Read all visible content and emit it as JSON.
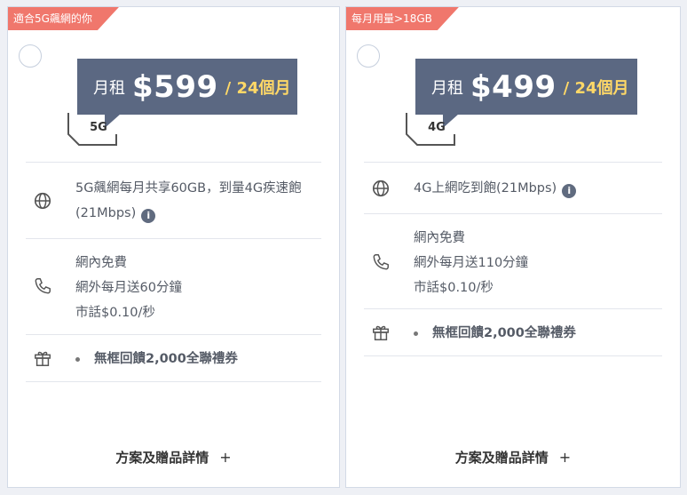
{
  "colors": {
    "tag": "#f0776c",
    "price_bg": "#5b6882",
    "term": "#ffd867"
  },
  "plans": [
    {
      "tag": "適合5G飆網的你",
      "rent_label": "月租",
      "price": "$599",
      "term": "/ 24個月",
      "network": "5G",
      "data_text": "5G飆網每月共享60GB，到量4G疾速飽(21Mbps)",
      "info_icon": "i",
      "voice_lines": [
        "網內免費",
        "網外每月送60分鐘",
        "市話$0.10/秒"
      ],
      "gift": "無框回饋2,000全聯禮券",
      "details_label": "方案及贈品詳情",
      "details_plus": "+"
    },
    {
      "tag": "每月用量>18GB",
      "rent_label": "月租",
      "price": "$499",
      "term": "/ 24個月",
      "network": "4G",
      "data_text": "4G上網吃到飽(21Mbps)",
      "info_icon": "i",
      "voice_lines": [
        "網內免費",
        "網外每月送110分鐘",
        "市話$0.10/秒"
      ],
      "gift": "無框回饋2,000全聯禮券",
      "details_label": "方案及贈品詳情",
      "details_plus": "+"
    }
  ]
}
